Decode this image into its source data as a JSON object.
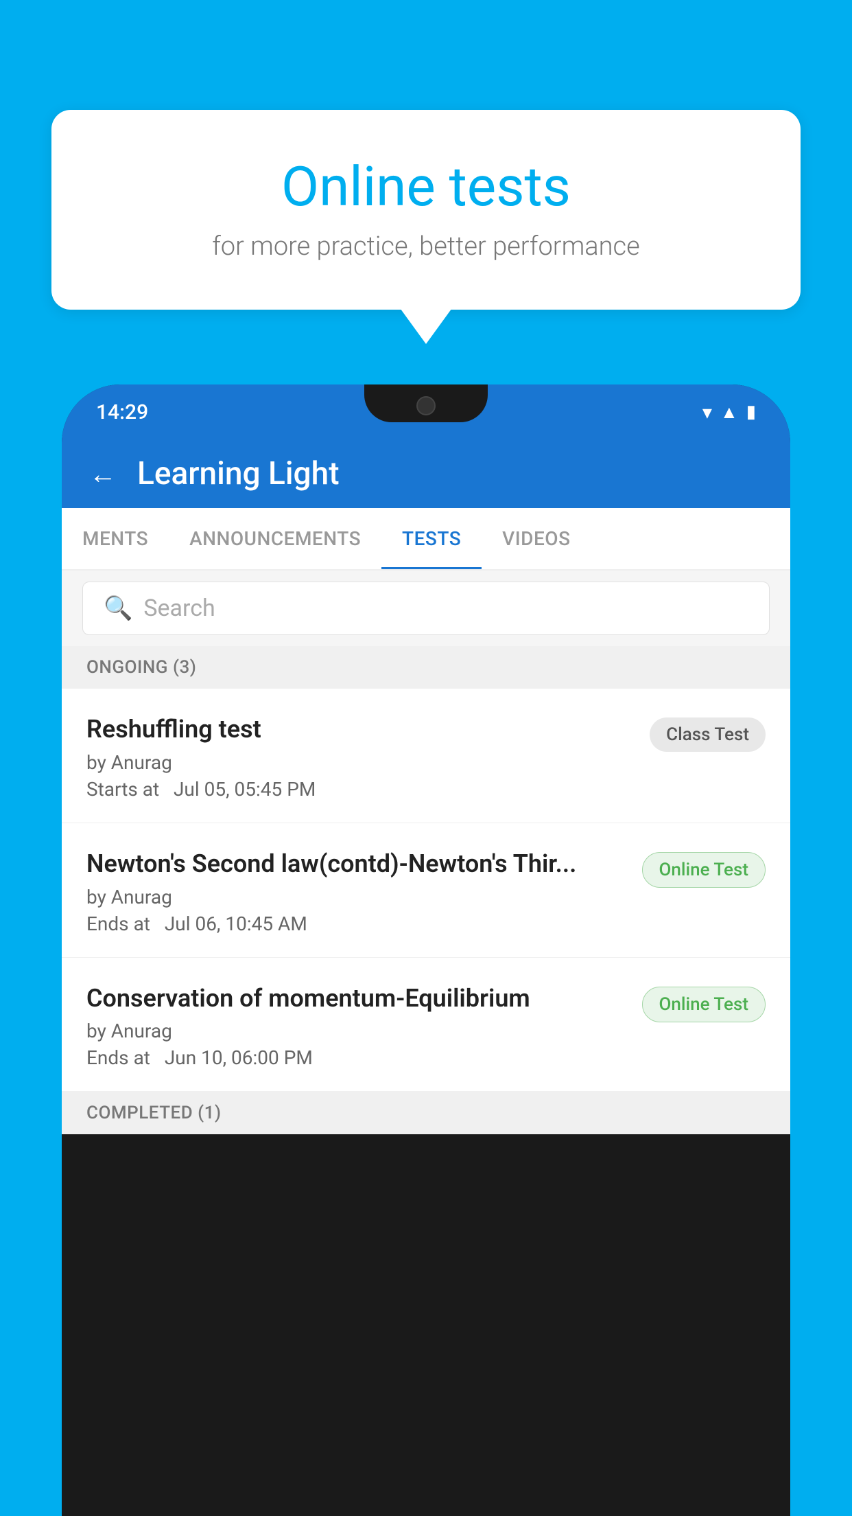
{
  "background": {
    "color": "#00AEEF"
  },
  "speech_bubble": {
    "title": "Online tests",
    "subtitle": "for more practice, better performance"
  },
  "phone": {
    "status_bar": {
      "time": "14:29",
      "icons": [
        "wifi",
        "signal",
        "battery"
      ]
    },
    "app_header": {
      "back_label": "←",
      "title": "Learning Light"
    },
    "tabs": [
      {
        "label": "MENTS",
        "active": false
      },
      {
        "label": "ANNOUNCEMENTS",
        "active": false
      },
      {
        "label": "TESTS",
        "active": true
      },
      {
        "label": "VIDEOS",
        "active": false
      }
    ],
    "search": {
      "placeholder": "Search"
    },
    "sections": [
      {
        "header": "ONGOING (3)",
        "items": [
          {
            "name": "Reshuffling test",
            "author": "by Anurag",
            "time_label": "Starts at",
            "time": "Jul 05, 05:45 PM",
            "badge": "Class Test",
            "badge_type": "class"
          },
          {
            "name": "Newton's Second law(contd)-Newton's Thir...",
            "author": "by Anurag",
            "time_label": "Ends at",
            "time": "Jul 06, 10:45 AM",
            "badge": "Online Test",
            "badge_type": "online"
          },
          {
            "name": "Conservation of momentum-Equilibrium",
            "author": "by Anurag",
            "time_label": "Ends at",
            "time": "Jun 10, 06:00 PM",
            "badge": "Online Test",
            "badge_type": "online"
          }
        ]
      },
      {
        "header": "COMPLETED (1)",
        "items": []
      }
    ]
  }
}
